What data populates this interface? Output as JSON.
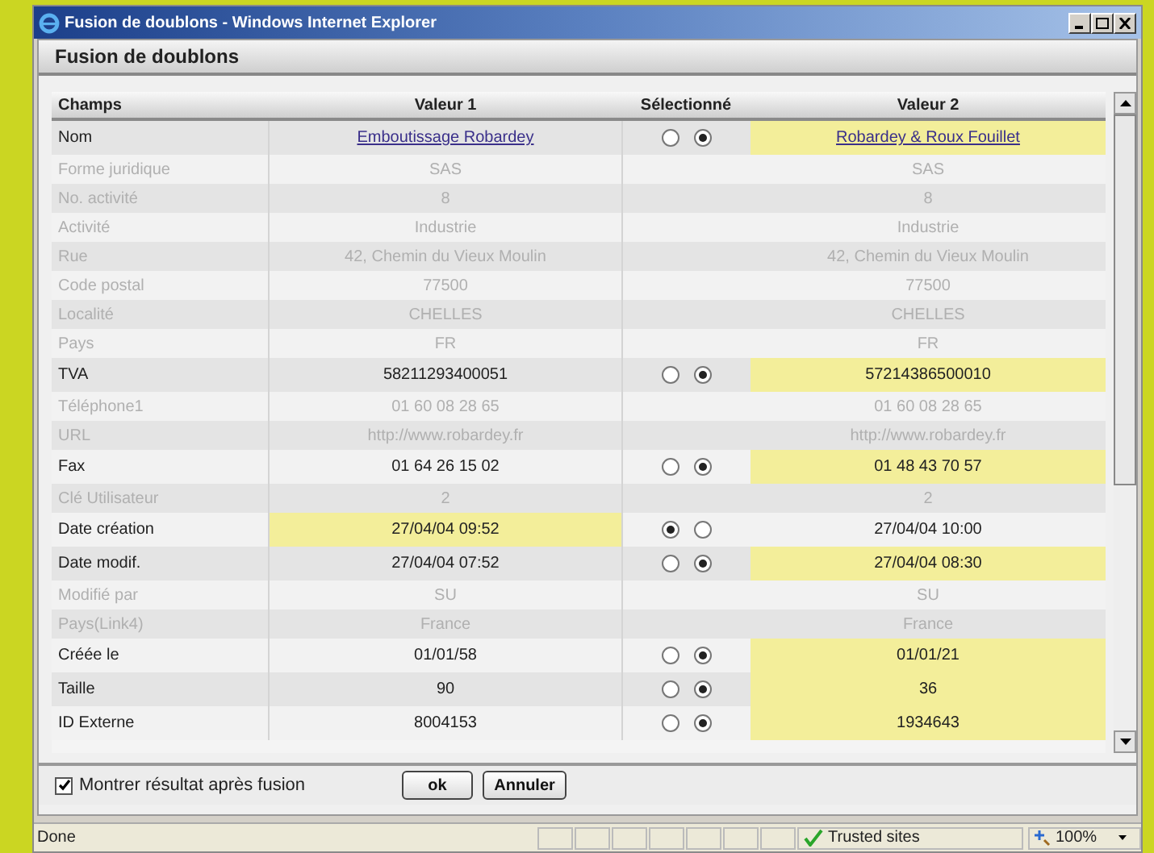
{
  "window": {
    "title": "Fusion de doublons - Windows Internet Explorer"
  },
  "dialog": {
    "title": "Fusion de doublons"
  },
  "table": {
    "columns": [
      "Champs",
      "Valeur 1",
      "Sélectionné",
      "Valeur 2"
    ],
    "rows": [
      {
        "kind": "choice",
        "field": "Nom",
        "value_1": "Emboutissage Robardey",
        "value_2": "Robardey & Roux Fouillet",
        "link": true,
        "choices": [
          {
            "selected": false
          },
          {
            "selected": true
          }
        ]
      },
      {
        "kind": "info",
        "field": "Forme juridique",
        "value_1": "SAS",
        "value_2": "SAS",
        "link": false
      },
      {
        "kind": "info",
        "field": "No. activité",
        "value_1": "8",
        "value_2": "8",
        "link": false
      },
      {
        "kind": "info",
        "field": "Activité",
        "value_1": "Industrie",
        "value_2": "Industrie",
        "link": false
      },
      {
        "kind": "info",
        "field": "Rue",
        "value_1": "42, Chemin du Vieux Moulin",
        "value_2": "42, Chemin du Vieux Moulin",
        "link": false
      },
      {
        "kind": "info",
        "field": "Code postal",
        "value_1": "77500",
        "value_2": "77500",
        "link": false
      },
      {
        "kind": "info",
        "field": "Localité",
        "value_1": "CHELLES",
        "value_2": "CHELLES",
        "link": false
      },
      {
        "kind": "info",
        "field": "Pays",
        "value_1": "FR",
        "value_2": "FR",
        "link": false
      },
      {
        "kind": "choice",
        "field": "TVA",
        "value_1": "58211293400051",
        "value_2": "57214386500010",
        "link": false,
        "choices": [
          {
            "selected": false
          },
          {
            "selected": true
          }
        ]
      },
      {
        "kind": "info",
        "field": "Téléphone1",
        "value_1": "01 60 08 28 65",
        "value_2": "01 60 08 28 65",
        "link": false
      },
      {
        "kind": "info",
        "field": "URL",
        "value_1": "http://www.robardey.fr",
        "value_2": "http://www.robardey.fr",
        "link": false
      },
      {
        "kind": "choice",
        "field": "Fax",
        "value_1": "01 64 26 15 02",
        "value_2": "01 48 43 70 57",
        "link": false,
        "choices": [
          {
            "selected": false
          },
          {
            "selected": true
          }
        ]
      },
      {
        "kind": "info",
        "field": "Clé Utilisateur",
        "value_1": "2",
        "value_2": "2",
        "link": false
      },
      {
        "kind": "choice",
        "field": "Date création",
        "value_1": "27/04/04 09:52",
        "value_2": "27/04/04 10:00",
        "link": false,
        "choices": [
          {
            "selected": true
          },
          {
            "selected": false
          }
        ]
      },
      {
        "kind": "choice",
        "field": "Date modif.",
        "value_1": "27/04/04 07:52",
        "value_2": "27/04/04 08:30",
        "link": false,
        "choices": [
          {
            "selected": false
          },
          {
            "selected": true
          }
        ]
      },
      {
        "kind": "info",
        "field": "Modifié par",
        "value_1": "SU",
        "value_2": "SU",
        "link": false
      },
      {
        "kind": "info",
        "field": "Pays(Link4)",
        "value_1": "France",
        "value_2": "France",
        "link": false
      },
      {
        "kind": "choice",
        "field": "Créée le",
        "value_1": "01/01/58",
        "value_2": "01/01/21",
        "link": false,
        "choices": [
          {
            "selected": false
          },
          {
            "selected": true
          }
        ]
      },
      {
        "kind": "choice",
        "field": "Taille",
        "value_1": "90",
        "value_2": "36",
        "link": false,
        "choices": [
          {
            "selected": false
          },
          {
            "selected": true
          }
        ]
      },
      {
        "kind": "choice",
        "field": "ID Externe",
        "value_1": "8004153",
        "value_2": "1934643",
        "link": false,
        "choices": [
          {
            "selected": false
          },
          {
            "selected": true
          }
        ]
      }
    ]
  },
  "footer": {
    "checkbox": {
      "label": "Montrer résultat après fusion",
      "checked": true
    },
    "buttons": [
      "ok",
      "Annuler"
    ]
  },
  "status_bar": {
    "status": "Done",
    "zone": "Trusted sites",
    "zoom": "100%"
  }
}
